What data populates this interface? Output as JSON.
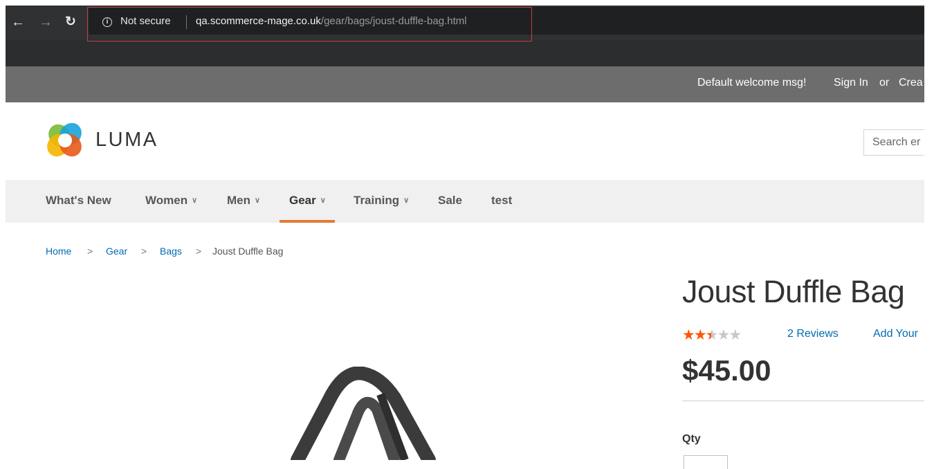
{
  "browser": {
    "security_label": "Not secure",
    "url_host": "qa.scommerce-mage.co.uk",
    "url_path": "/gear/bags/joust-duffle-bag.html"
  },
  "panel": {
    "welcome": "Default welcome msg!",
    "sign_in": "Sign In",
    "or": "or",
    "create_account": "Crea"
  },
  "header": {
    "logo_text": "LUMA",
    "search_placeholder": "Search er"
  },
  "nav": {
    "items": [
      {
        "label": "What's New",
        "has_submenu": false
      },
      {
        "label": "Women",
        "has_submenu": true
      },
      {
        "label": "Men",
        "has_submenu": true
      },
      {
        "label": "Gear",
        "has_submenu": true,
        "active": true
      },
      {
        "label": "Training",
        "has_submenu": true
      },
      {
        "label": "Sale",
        "has_submenu": false
      },
      {
        "label": "test",
        "has_submenu": false
      }
    ]
  },
  "breadcrumbs": {
    "items": [
      "Home",
      "Gear",
      "Bags",
      "Joust Duffle Bag"
    ],
    "separator": ">"
  },
  "product": {
    "title": "Joust Duffle Bag",
    "rating_fraction": 0.5,
    "reviews_label": "2  Reviews",
    "add_review_label": "Add Your",
    "price": "$45.00",
    "qty_label": "Qty"
  },
  "colors": {
    "accent": "#e07b39",
    "link": "#006bb4",
    "star": "#ff5501",
    "panel_bg": "#6d6d6d"
  },
  "icons": {
    "back": "arrow-left-icon",
    "forward": "arrow-right-icon",
    "reload": "reload-icon",
    "info": "info-icon",
    "chevron": "chevron-down-icon",
    "logo": "luma-logo-icon"
  }
}
